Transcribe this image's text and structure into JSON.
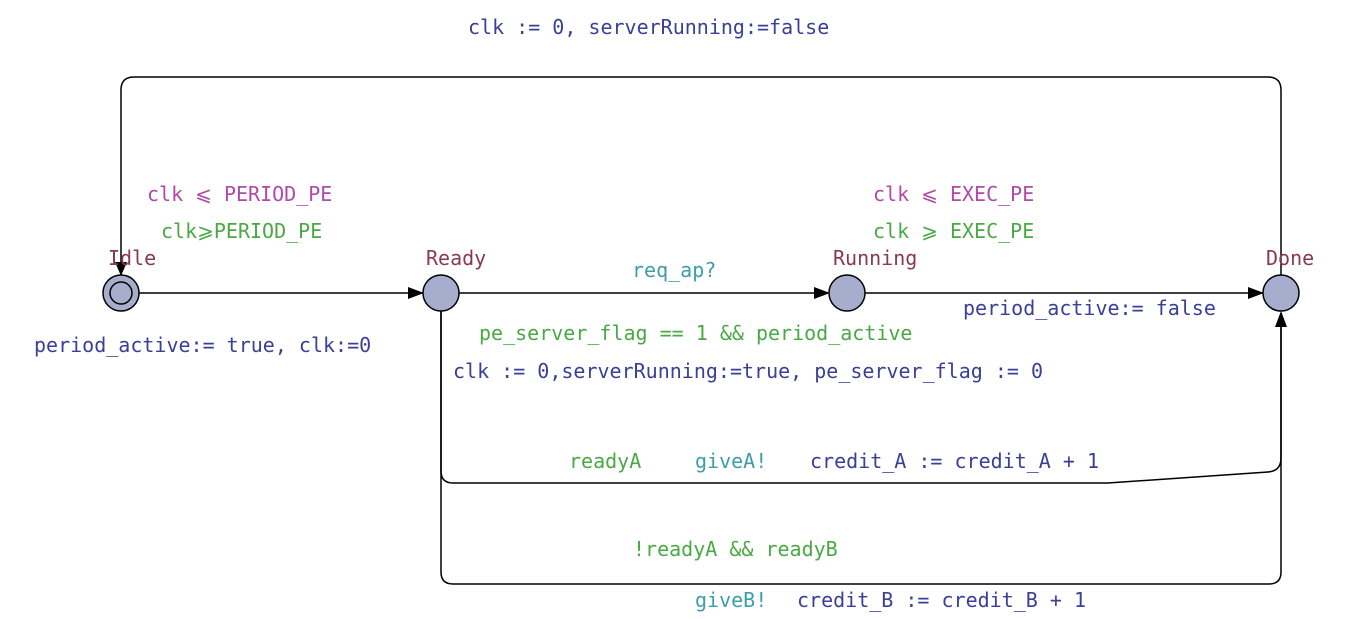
{
  "locations": {
    "idle": "Idle",
    "ready": "Ready",
    "running": "Running",
    "done": "Done"
  },
  "invariants": {
    "idle": "clk ⩽ PERIOD_PE",
    "running": "clk ⩽ EXEC_PE"
  },
  "edges": {
    "reset": {
      "assignment": "clk := 0, serverRunning:=false"
    },
    "idle_ready": {
      "guard": "clk⩾PERIOD_PE",
      "assignment": "period_active:= true, clk:=0"
    },
    "ready_running": {
      "sync": "req_ap?",
      "guard": "pe_server_flag == 1 && period_active",
      "assignment": "clk := 0,serverRunning:=true, pe_server_flag := 0"
    },
    "running_done": {
      "guard": "clk ⩾ EXEC_PE",
      "assignment": "period_active:= false"
    },
    "ready_done_a": {
      "guard": "readyA",
      "sync": "giveA!",
      "assignment": "credit_A := credit_A + 1"
    },
    "ready_done_b": {
      "guard": "!readyA && readyB",
      "sync": "giveB!",
      "assignment": "credit_B := credit_B + 1"
    }
  },
  "colors": {
    "location_name": "#8a3a4f",
    "invariant": "#b04aa6",
    "guard": "#4aa845",
    "sync": "#3d9ea8",
    "assignment": "#3a3f97",
    "node_fill": "#a7aecd"
  }
}
